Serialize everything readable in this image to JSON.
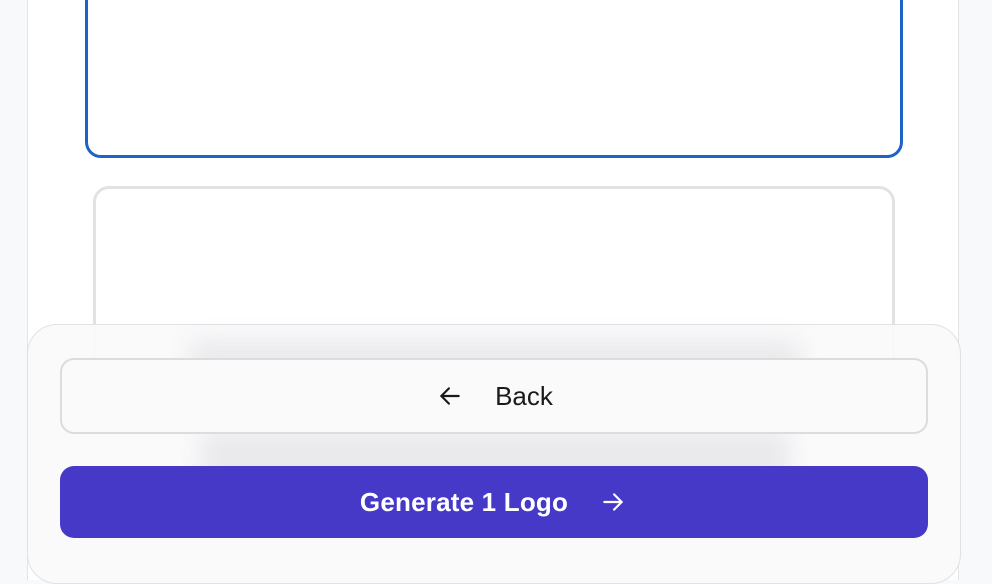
{
  "actions": {
    "back_label": "Back",
    "generate_label": "Generate 1 Logo",
    "back_icon": "arrow-left-icon",
    "generate_icon": "arrow-right-icon"
  },
  "colors": {
    "primary": "#4739c8",
    "selected_border": "#1b63c6",
    "card_border": "#e2e2e4",
    "back_button_bg": "#fafafa"
  },
  "options": {
    "selected_index": 0
  }
}
